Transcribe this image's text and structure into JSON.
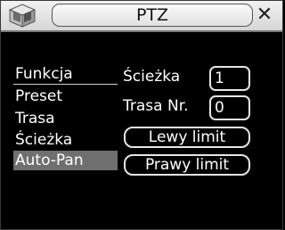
{
  "window": {
    "title": "PTZ"
  },
  "menu": {
    "header": "Funkcja",
    "items": [
      {
        "label": "Preset"
      },
      {
        "label": "Trasa"
      },
      {
        "label": "Ścieżka"
      },
      {
        "label": "Auto-Pan"
      }
    ],
    "selected": "Auto-Pan"
  },
  "fields": {
    "path_label": "Ścieżka",
    "path_value": "1",
    "route_label": "Trasa Nr.",
    "route_value": "0"
  },
  "buttons": {
    "left_limit": "Lewy limit",
    "right_limit": "Prawy limit"
  },
  "colors": {
    "background": "#000000",
    "selected_item": "#6f6f6f",
    "text": "#ffffff"
  }
}
